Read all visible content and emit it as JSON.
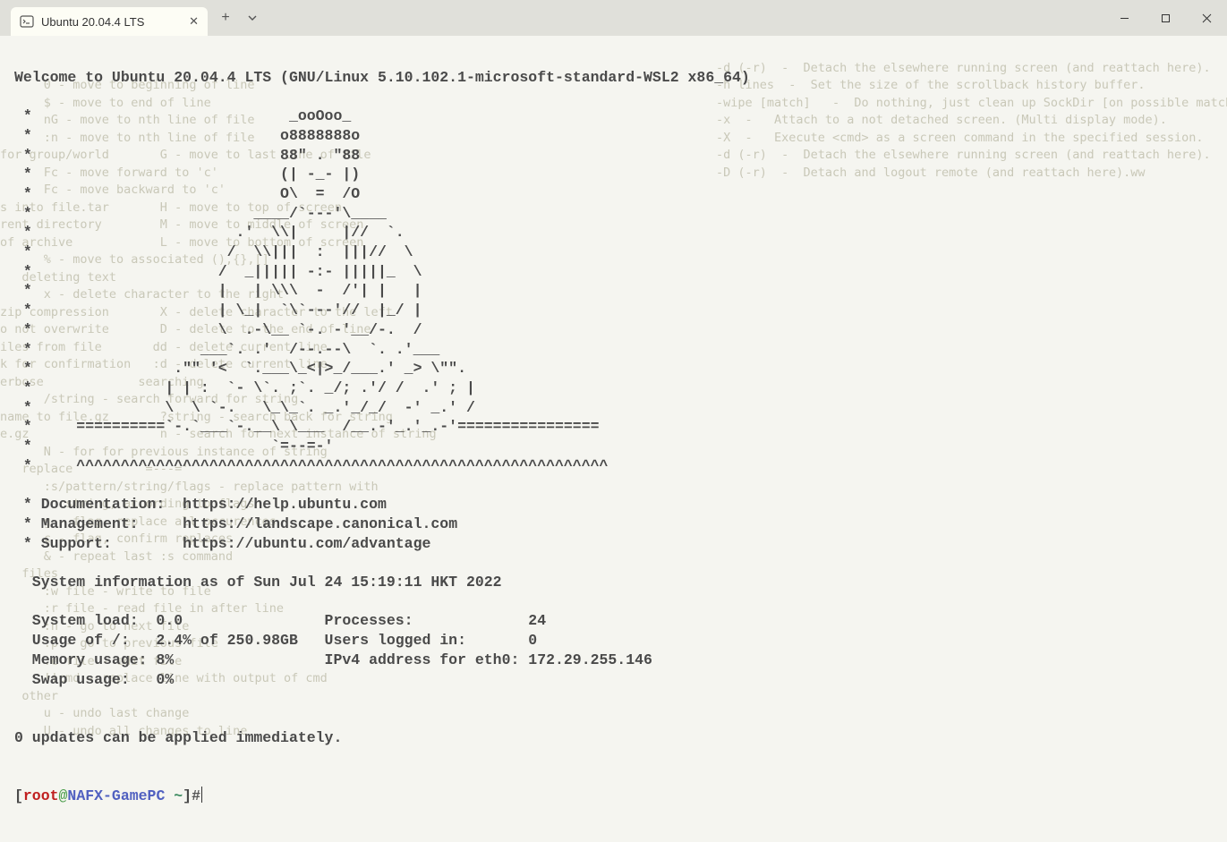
{
  "tab": {
    "title": "Ubuntu 20.04.4 LTS"
  },
  "welcome": "Welcome to Ubuntu 20.04.4 LTS (GNU/Linux 5.10.102.1-microsoft-standard-WSL2 x86_64)",
  "ascii": " *                             _ooOoo_\n *                            o8888888o\n *                            88\" . \"88\n *                            (| -_- |)\n *                            O\\  =  /O\n *                         ____/`---'\\____\n *                       .'  \\\\|     |//  `.\n *                      /  \\\\|||  :  |||//  \\\n *                     /  _||||| -:- |||||_  \\\n *                     |   | \\\\\\  -  /'| |   |\n *                     | \\_|  `\\`---'//  |_/ |\n *                     \\  .-\\__ `-. -'__/-.  /\n *                   ___`. .'  /--.--\\  `. .'___\n *                .\"\" '<  `.___\\_<|>_/___.' _> \\\"\".\n *               | | :  `- \\`. ;`. _/; .'/ /  .' ; |\n *               \\  \\ `-.   \\_\\_`. _.'_/_/  -' _.' /\n *     ==========`-.`___`-.__\\ \\___  /__.-'_.'_.-'================\n *                           `=--=-'\n *     ^^^^^^^^^^^^^^^^^^^^^^^^^^^^^^^^^^^^^^^^^^^^^^^^^^^^^^^^^^^^",
  "links": {
    "doc_label": " * Documentation:  ",
    "doc_url": "https://help.ubuntu.com",
    "mgmt_label": " * Management:     ",
    "mgmt_url": "https://landscape.canonical.com",
    "sup_label": " * Support:        ",
    "sup_url": "https://ubuntu.com/advantage"
  },
  "sysinfo_header": "  System information as of Sun Jul 24 15:19:11 HKT 2022",
  "stats": {
    "line1": "  System load:  0.0                Processes:             24",
    "line2": "  Usage of /:   2.4% of 250.98GB   Users logged in:       0",
    "line3": "  Memory usage: 8%                 IPv4 address for eth0: 172.29.255.146",
    "line4": "  Swap usage:   0%"
  },
  "updates": "0 updates can be applied immediately.",
  "prompt": {
    "open": "[",
    "user": "root",
    "at": "@",
    "host": "NAFX-GamePC",
    "path": " ~",
    "close": "]",
    "symbol": "#"
  },
  "bg_right": "-d (-r)  -  Detach the elsewhere running screen (and reattach here).\n-h lines  -  Set the size of the scrollback history buffer.\n-wipe [match]   -  Do nothing, just clean up SockDir [on possible matches].\n-x  -   Attach to a not detached screen. (Multi display mode).\n-X  -   Execute <cmd> as a screen command in the specified session.\n-d (-r)  -  Detach the elsewhere running screen (and reattach here).\n-D (-r)  -  Detach and logout remote (and reattach here).ww",
  "bg_left": "\n\n      0 - move to beginning of line\n      $ - move to end of line\n      nG - move to nth line of file\n      :n - move to nth line of file\nfor group/world       G - move to last line of file\n      Fc - move forward to 'c'\n      Fc - move backward to 'c'\ns into file.tar       H - move to top of screen\nrent directory        M - move to middle of screen\nof archive            L - move to bottom of screen\n      % - move to associated (),{},[]\n   deleting text\n      x - delete character to the right\nzip compression       X - delete character to the left\no not overwrite       D - delete to the end of line\niles from file       dd - delete current line\nk for confirmation   :d - delete current line\nerbose             searching\n      /string - search forward for string\nname to file.gz       ?string - search back for string\ne.gz                  n - search for next instance of string\n      N - for for previous instance of string\n   replace         `=---='\n      :s/pattern/string/flags - replace pattern with\n         string, according to flags\n      g - flag, replace all occurences\n      c - flag, confirm replaces\n      & - repeat last :s command\n   files\n      :w file - write to file\n      :r file - read file in after line\n      :n - go to next file\n      :p - go to previous file\n      :e file - edit file\n      !!cmd - replace line with output of cmd\n   other\n      u - undo last change\n      U - undo all changes to line"
}
